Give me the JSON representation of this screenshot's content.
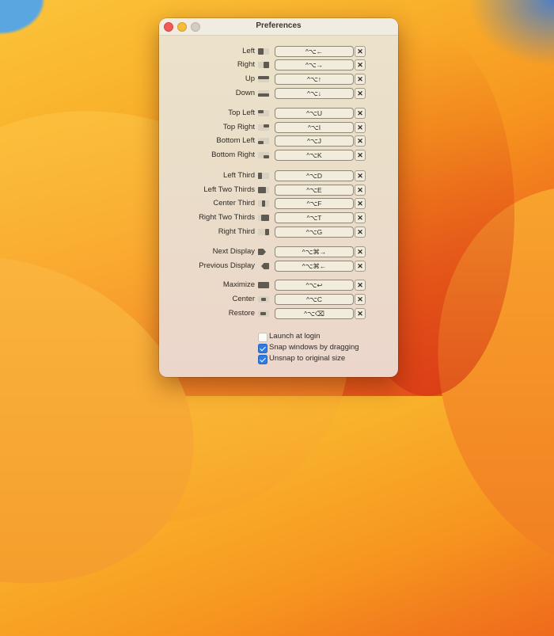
{
  "window": {
    "title": "Preferences",
    "traffic_lights": [
      "close",
      "minimize",
      "zoom"
    ]
  },
  "shortcuts": [
    {
      "label": "Left",
      "icon": "left-half-icon",
      "keys": "^⌥←",
      "group": 1
    },
    {
      "label": "Right",
      "icon": "right-half-icon",
      "keys": "^⌥→",
      "group": 1
    },
    {
      "label": "Up",
      "icon": "top-half-icon",
      "keys": "^⌥↑",
      "group": 1
    },
    {
      "label": "Down",
      "icon": "bottom-half-icon",
      "keys": "^⌥↓",
      "group": 1
    },
    {
      "label": "Top Left",
      "icon": "top-left-icon",
      "keys": "^⌥U",
      "group": 2
    },
    {
      "label": "Top Right",
      "icon": "top-right-icon",
      "keys": "^⌥I",
      "group": 2
    },
    {
      "label": "Bottom Left",
      "icon": "bottom-left-icon",
      "keys": "^⌥J",
      "group": 2
    },
    {
      "label": "Bottom Right",
      "icon": "bottom-right-icon",
      "keys": "^⌥K",
      "group": 2
    },
    {
      "label": "Left Third",
      "icon": "left-third-icon",
      "keys": "^⌥D",
      "group": 3
    },
    {
      "label": "Left Two Thirds",
      "icon": "left-two-thirds-icon",
      "keys": "^⌥E",
      "group": 3
    },
    {
      "label": "Center Third",
      "icon": "center-third-icon",
      "keys": "^⌥F",
      "group": 3
    },
    {
      "label": "Right Two Thirds",
      "icon": "right-two-thirds-icon",
      "keys": "^⌥T",
      "group": 3
    },
    {
      "label": "Right Third",
      "icon": "right-third-icon",
      "keys": "^⌥G",
      "group": 3
    },
    {
      "label": "Next Display",
      "icon": "next-display-icon",
      "keys": "^⌥⌘→",
      "group": 4
    },
    {
      "label": "Previous Display",
      "icon": "previous-display-icon",
      "keys": "^⌥⌘←",
      "group": 4
    },
    {
      "label": "Maximize",
      "icon": "maximize-icon",
      "keys": "^⌥↩",
      "group": 5
    },
    {
      "label": "Center",
      "icon": "center-icon",
      "keys": "^⌥C",
      "group": 5
    },
    {
      "label": "Restore",
      "icon": "restore-icon",
      "keys": "^⌥⌫",
      "group": 5
    }
  ],
  "clear_label": "✕",
  "options": [
    {
      "label": "Launch at login",
      "checked": false
    },
    {
      "label": "Snap windows by dragging",
      "checked": true
    },
    {
      "label": "Unsnap to original size",
      "checked": true
    }
  ],
  "colors": {
    "checkbox_accent": "#2e7be6",
    "close": "#f05c55",
    "minimize": "#f4bd3a",
    "zoom_inactive": "#d3ccc0"
  }
}
